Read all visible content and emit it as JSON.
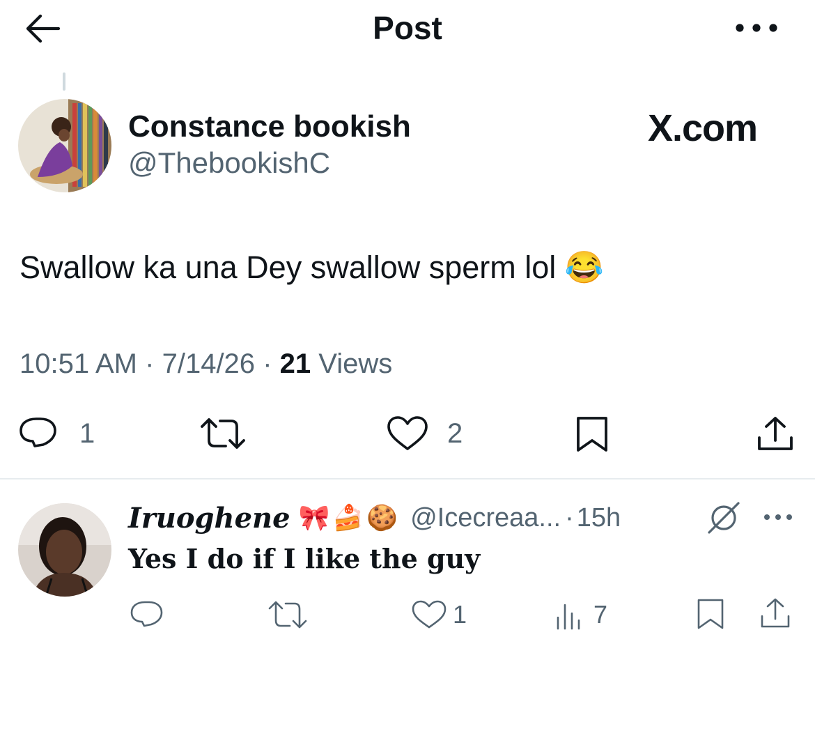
{
  "header": {
    "title": "Post"
  },
  "post": {
    "author_name": "Constance bookish",
    "author_handle": "@ThebookishC",
    "watermark": "X.com",
    "text": "Swallow ka una Dey swallow sperm lol",
    "emoji": "😂",
    "time": "10:51 AM",
    "date": "7/14/26",
    "views_count": "21",
    "views_label": "Views",
    "sep": "·",
    "actions": {
      "replies": "1",
      "reposts": "",
      "likes": "2"
    }
  },
  "reply": {
    "author_name": "Iruoghene",
    "name_emojis": "🎀🍰🍪",
    "author_handle": "@Icecreaa...",
    "sep": "·",
    "age": "15h",
    "text": "Yes I do if I like the guy",
    "actions": {
      "replies": "",
      "reposts": "",
      "likes": "1",
      "views": "7"
    }
  },
  "colors": {
    "text": "#0f1419",
    "secondary": "#536471",
    "divider": "#e7ecef",
    "background": "#ffffff"
  },
  "icons": [
    "back-arrow-icon",
    "more-icon",
    "reply-icon",
    "repost-icon",
    "like-icon",
    "bookmark-icon",
    "share-icon",
    "views-icon",
    "no-reach-icon"
  ]
}
